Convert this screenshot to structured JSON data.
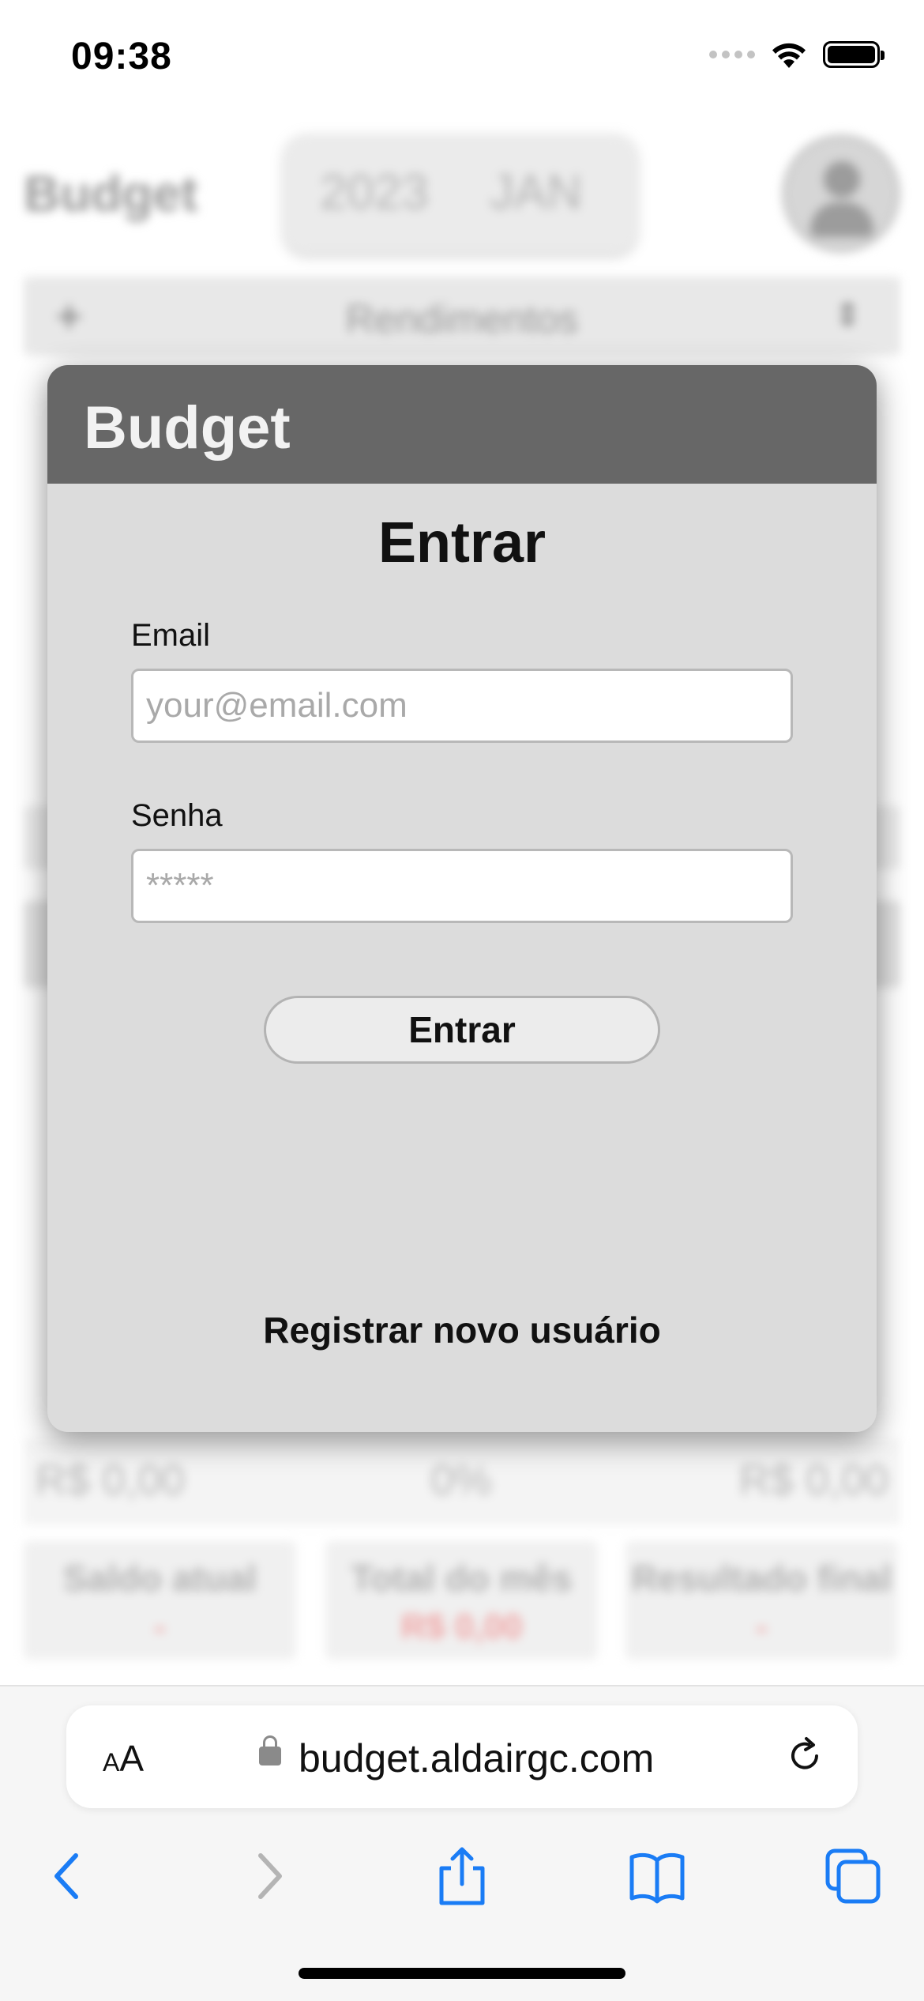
{
  "status_bar": {
    "time": "09:38",
    "icons": [
      "cellular-signal-icon",
      "wifi-icon",
      "battery-icon"
    ]
  },
  "background_app": {
    "title": "Budget",
    "picker": {
      "year": "2023",
      "month": "JAN"
    },
    "section_bar": {
      "label": "Rendimentos"
    },
    "totals": [
      "R$ 0,00",
      "0%",
      "R$ 0,00"
    ],
    "cards": [
      {
        "label": "Saldo atual",
        "value": "-"
      },
      {
        "label": "Total do mês",
        "value": "R$ 0,00"
      },
      {
        "label": "Resultado final",
        "value": "-"
      }
    ]
  },
  "modal": {
    "brand": "Budget",
    "title": "Entrar",
    "email": {
      "label": "Email",
      "placeholder": "your@email.com",
      "value": ""
    },
    "password": {
      "label": "Senha",
      "placeholder": "*****",
      "value": ""
    },
    "submit_label": "Entrar",
    "register_label": "Registrar novo usuário"
  },
  "browser": {
    "text_size_label": "AA",
    "url": "budget.aldairgc.com",
    "accent_color": "#1a7cf5",
    "toolbar_icons": [
      "back-icon",
      "forward-icon",
      "share-icon",
      "bookmarks-icon",
      "tabs-icon"
    ]
  }
}
